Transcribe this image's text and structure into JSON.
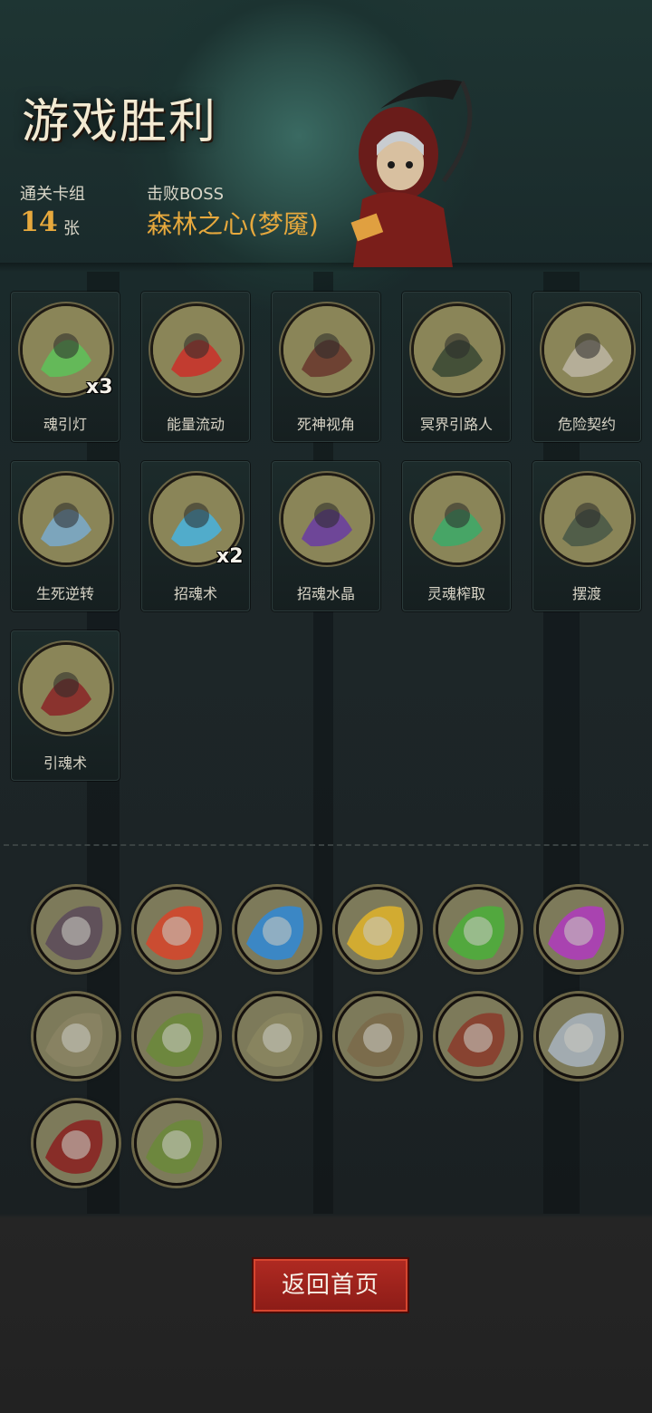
{
  "title": "游戏胜利",
  "stats": {
    "deck_label": "通关卡组",
    "deck_count": "14",
    "deck_unit": "张",
    "boss_label": "击败BOSS",
    "boss_name": "森林之心(梦魇)"
  },
  "cards": [
    {
      "name": "魂引灯",
      "mult": "x3",
      "icon": "soul-lantern-icon",
      "color": "#5fbf5a"
    },
    {
      "name": "能量流动",
      "mult": "",
      "icon": "energy-flow-icon",
      "color": "#c8342c"
    },
    {
      "name": "死神视角",
      "mult": "",
      "icon": "reaper-view-icon",
      "color": "#6a3b30"
    },
    {
      "name": "冥界引路人",
      "mult": "",
      "icon": "underworld-guide-icon",
      "color": "#3c4a35"
    },
    {
      "name": "危险契约",
      "mult": "",
      "icon": "danger-contract-icon",
      "color": "#b9b2a0"
    },
    {
      "name": "生死逆转",
      "mult": "",
      "icon": "life-death-reversal-icon",
      "color": "#7aa8c8"
    },
    {
      "name": "招魂术",
      "mult": "x2",
      "icon": "summon-soul-icon",
      "color": "#4ab0d8"
    },
    {
      "name": "招魂水晶",
      "mult": "",
      "icon": "soul-crystal-icon",
      "color": "#6a3fa0"
    },
    {
      "name": "灵魂榨取",
      "mult": "",
      "icon": "soul-extraction-icon",
      "color": "#3fa868"
    },
    {
      "name": "摆渡",
      "mult": "",
      "icon": "ferry-icon",
      "color": "#4a5a48"
    },
    {
      "name": "引魂术",
      "mult": "",
      "icon": "soul-guiding-icon",
      "color": "#8a2a2a"
    }
  ],
  "relics": [
    {
      "icon": "dark-nest-icon",
      "color": "#5a4a5a"
    },
    {
      "icon": "skull-music-red-icon",
      "color": "#d8442a"
    },
    {
      "icon": "skull-music-blue-icon",
      "color": "#2f8ad8"
    },
    {
      "icon": "skull-music-yellow-icon",
      "color": "#e0b42a"
    },
    {
      "icon": "skull-music-green-icon",
      "color": "#4ab03a"
    },
    {
      "icon": "skull-music-purple-icon",
      "color": "#b03ac0"
    },
    {
      "icon": "treasure-chest-icon",
      "color": "#8a8464"
    },
    {
      "icon": "ghost-ogre-icon",
      "color": "#6a8a3a"
    },
    {
      "icon": "scythe-blade-icon",
      "color": "#8a8660"
    },
    {
      "icon": "swordsman-icon",
      "color": "#7a6a4a"
    },
    {
      "icon": "vampire-icon",
      "color": "#8a3a2a"
    },
    {
      "icon": "dagger-icon",
      "color": "#a8b4c0"
    },
    {
      "icon": "red-banner-icon",
      "color": "#8a2020"
    },
    {
      "icon": "ghost-ogre-2-icon",
      "color": "#6a8a3a"
    }
  ],
  "button": {
    "return_label": "返回首页"
  }
}
